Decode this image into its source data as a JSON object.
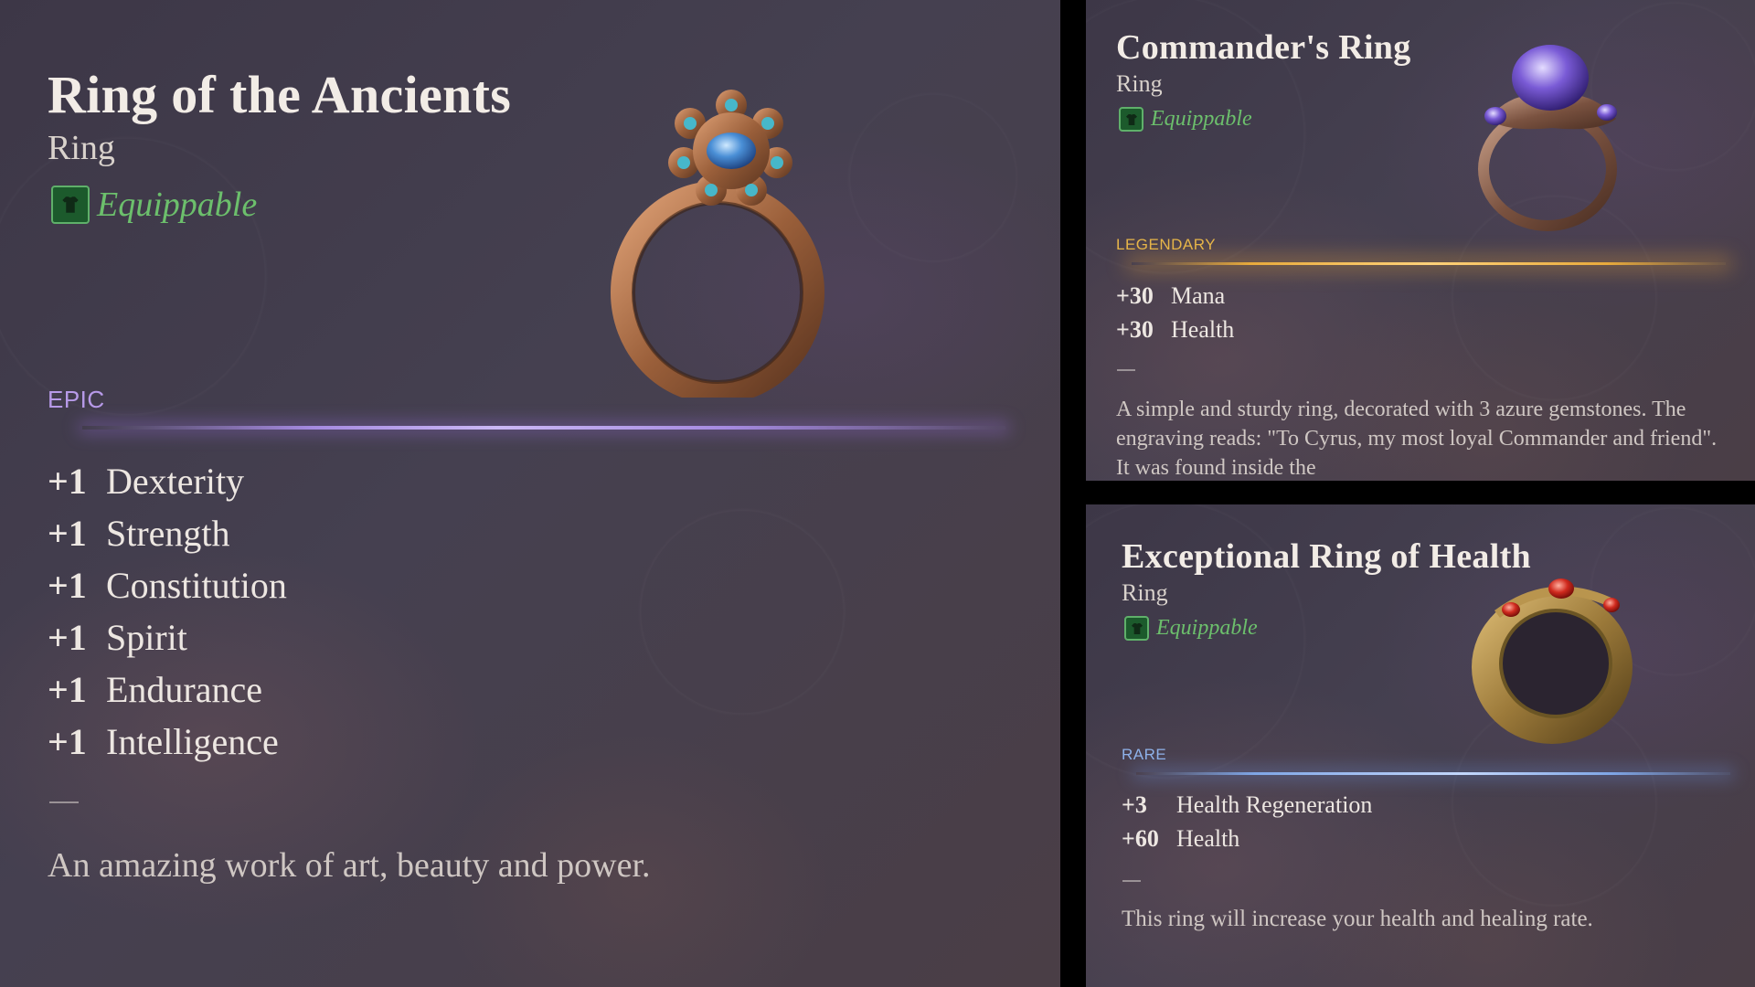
{
  "items": [
    {
      "title": "Ring of the Ancients",
      "type": "Ring",
      "equip_label": "Equippable",
      "rarity": "EPIC",
      "stats": [
        {
          "value": "+1",
          "name": "Dexterity"
        },
        {
          "value": "+1",
          "name": "Strength"
        },
        {
          "value": "+1",
          "name": "Constitution"
        },
        {
          "value": "+1",
          "name": "Spirit"
        },
        {
          "value": "+1",
          "name": "Endurance"
        },
        {
          "value": "+1",
          "name": "Intelligence"
        }
      ],
      "separator": "—",
      "description": "An amazing work of art, beauty and power.",
      "icon": "azure-gem-ring-icon"
    },
    {
      "title": "Commander's Ring",
      "type": "Ring",
      "equip_label": "Equippable",
      "rarity": "LEGENDARY",
      "stats": [
        {
          "value": "+30",
          "name": "Mana"
        },
        {
          "value": "+30",
          "name": "Health"
        }
      ],
      "separator": "—",
      "description": "A simple and sturdy ring, decorated with 3 azure gemstones. The engraving reads: \"To Cyrus, my most loyal Commander and friend\". It was found inside the",
      "icon": "violet-gem-ring-icon"
    },
    {
      "title": "Exceptional Ring of Health",
      "type": "Ring",
      "equip_label": "Equippable",
      "rarity": "RARE",
      "stats": [
        {
          "value": "+3",
          "name": "Health Regeneration"
        },
        {
          "value": "+60",
          "name": "Health"
        }
      ],
      "separator": "—",
      "description": "This ring will increase your health and healing rate.",
      "icon": "ruby-band-ring-icon"
    }
  ],
  "colors": {
    "epic": "#b79ae8",
    "legendary": "#e6b64a",
    "rare": "#8fb2ea",
    "equippable": "#6cbf6c"
  }
}
